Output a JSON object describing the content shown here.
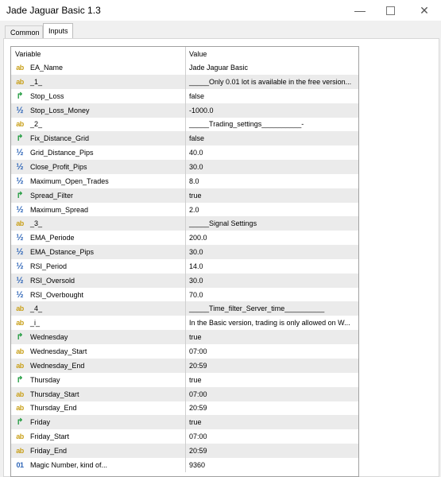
{
  "window": {
    "title": "Jade Jaguar Basic 1.3",
    "minimize_glyph": "—",
    "close_glyph": "✕"
  },
  "tabs": [
    {
      "label": "Common",
      "active": false
    },
    {
      "label": "Inputs",
      "active": true
    }
  ],
  "table": {
    "headers": {
      "variable": "Variable",
      "value": "Value"
    },
    "rows": [
      {
        "icon": "ab",
        "name": "EA_Name",
        "value": "Jade Jaguar Basic"
      },
      {
        "icon": "ab",
        "name": "_1_",
        "value": "_____Only 0.01 lot is available in the free version..."
      },
      {
        "icon": "arrow",
        "name": "Stop_Loss",
        "value": "false"
      },
      {
        "icon": "half",
        "name": "Stop_Loss_Money",
        "value": "-1000.0"
      },
      {
        "icon": "ab",
        "name": "_2_",
        "value": "_____Trading_settings__________-"
      },
      {
        "icon": "arrow",
        "name": "Fix_Distance_Grid",
        "value": "false"
      },
      {
        "icon": "half",
        "name": "Grid_Distance_Pips",
        "value": "40.0"
      },
      {
        "icon": "half",
        "name": "Close_Profit_Pips",
        "value": "30.0"
      },
      {
        "icon": "half",
        "name": "Maximum_Open_Trades",
        "value": "8.0"
      },
      {
        "icon": "arrow",
        "name": "Spread_Filter",
        "value": "true"
      },
      {
        "icon": "half",
        "name": "Maximum_Spread",
        "value": "2.0"
      },
      {
        "icon": "ab",
        "name": "_3_",
        "value": "_____Signal Settings"
      },
      {
        "icon": "half",
        "name": "EMA_Periode",
        "value": "200.0"
      },
      {
        "icon": "half",
        "name": "EMA_Dstance_Pips",
        "value": "30.0"
      },
      {
        "icon": "half",
        "name": "RSI_Period",
        "value": "14.0"
      },
      {
        "icon": "half",
        "name": "RSI_Oversold",
        "value": "30.0"
      },
      {
        "icon": "half",
        "name": "RSI_Overbought",
        "value": "70.0"
      },
      {
        "icon": "ab",
        "name": "_4_",
        "value": "_____Time_filter_Server_time__________"
      },
      {
        "icon": "ab",
        "name": "_i_",
        "value": "In the Basic version, trading is only allowed on W..."
      },
      {
        "icon": "arrow",
        "name": "Wednesday",
        "value": "true"
      },
      {
        "icon": "ab",
        "name": "Wednesday_Start",
        "value": "07:00"
      },
      {
        "icon": "ab",
        "name": "Wednesday_End",
        "value": "20:59"
      },
      {
        "icon": "arrow",
        "name": "Thursday",
        "value": "true"
      },
      {
        "icon": "ab",
        "name": "Thursday_Start",
        "value": "07:00"
      },
      {
        "icon": "ab",
        "name": "Thursday_End",
        "value": "20:59"
      },
      {
        "icon": "arrow",
        "name": "Friday",
        "value": "true"
      },
      {
        "icon": "ab",
        "name": "Friday_Start",
        "value": "07:00"
      },
      {
        "icon": "ab",
        "name": "Friday_End",
        "value": "20:59"
      },
      {
        "icon": "num",
        "name": "Magic Number, kind of...",
        "value": "9360"
      }
    ]
  },
  "icons": {
    "ab": {
      "glyph": "ab",
      "semantic": "string-type-icon",
      "color": "#c9a01a"
    },
    "half": {
      "glyph": "½",
      "semantic": "double-type-icon",
      "color": "#2f66b8"
    },
    "arrow": {
      "glyph": "↱",
      "semantic": "bool-type-icon",
      "color": "#1d9a3c"
    },
    "num": {
      "glyph": "01",
      "semantic": "integer-type-icon",
      "color": "#2f66b8"
    }
  }
}
